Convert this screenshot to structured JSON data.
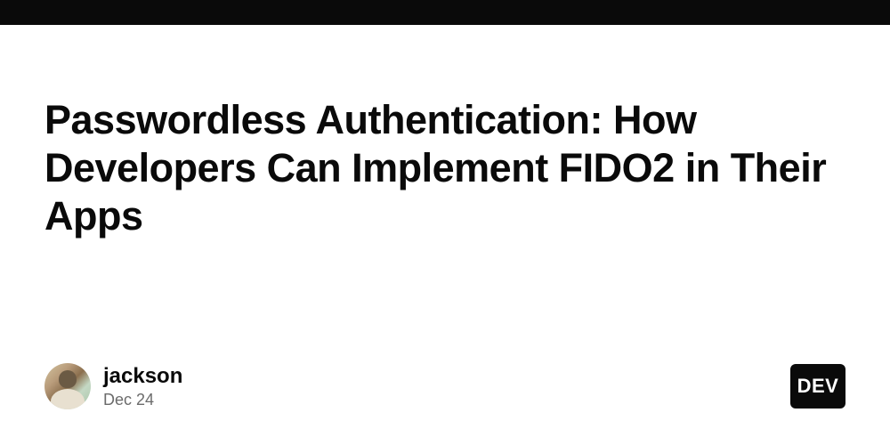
{
  "post": {
    "title": "Passwordless Authentication: How Developers Can Implement FIDO2 in Their Apps"
  },
  "author": {
    "name": "jackson",
    "date": "Dec 24"
  },
  "brand": {
    "label": "DEV"
  }
}
